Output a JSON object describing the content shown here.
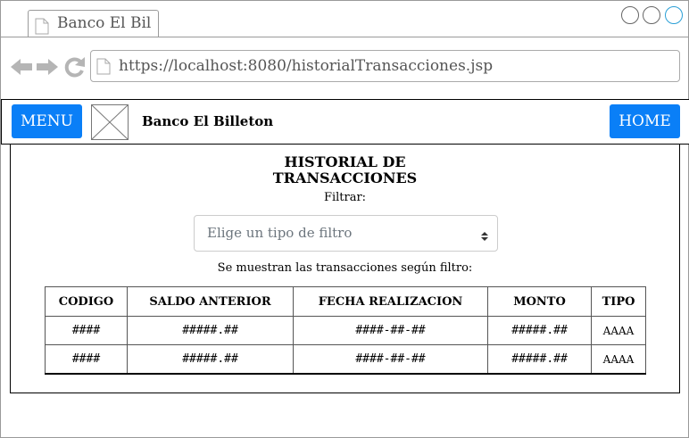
{
  "browser": {
    "tab_title": "Banco El Bil",
    "url": "https://localhost:8080/historialTransacciones.jsp"
  },
  "navbar": {
    "menu_label": "MENU",
    "brand_name": "Banco El Billeton",
    "home_label": "HOME"
  },
  "page": {
    "title_line1": "HISTORIAL DE",
    "title_line2": "TRANSACCIONES",
    "filter_label": "Filtrar:",
    "filter_placeholder": "Elige un tipo de filtro",
    "info_text": "Se muestran las transacciones según filtro:"
  },
  "table": {
    "headers": [
      "CODIGO",
      "SALDO ANTERIOR",
      "FECHA REALIZACION",
      "MONTO",
      "TIPO"
    ],
    "rows": [
      [
        "####",
        "#####.##",
        "####-##-##",
        "#####.##",
        "AAAA"
      ],
      [
        "####",
        "#####.##",
        "####-##-##",
        "#####.##",
        "AAAA"
      ]
    ]
  },
  "colors": {
    "button_blue": "#0a7ff7",
    "active_window_control": "#2a9fd6"
  }
}
